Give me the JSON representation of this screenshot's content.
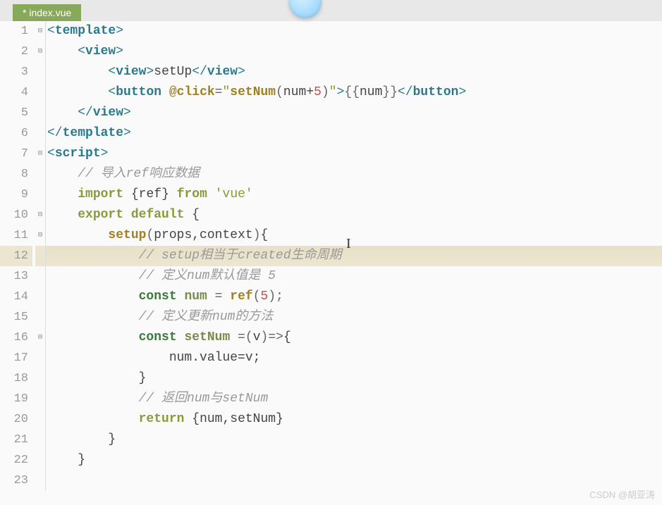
{
  "tab": {
    "title": "* index.vue"
  },
  "watermark": "CSDN @胡亚涛",
  "lines": [
    {
      "num": "1",
      "fold": "⊟",
      "hl": false
    },
    {
      "num": "2",
      "fold": "⊟",
      "hl": false
    },
    {
      "num": "3",
      "fold": "",
      "hl": false
    },
    {
      "num": "4",
      "fold": "",
      "hl": false
    },
    {
      "num": "5",
      "fold": "",
      "hl": false
    },
    {
      "num": "6",
      "fold": "",
      "hl": false
    },
    {
      "num": "7",
      "fold": "⊟",
      "hl": false
    },
    {
      "num": "8",
      "fold": "",
      "hl": false
    },
    {
      "num": "9",
      "fold": "",
      "hl": false
    },
    {
      "num": "10",
      "fold": "⊟",
      "hl": false
    },
    {
      "num": "11",
      "fold": "⊟",
      "hl": false
    },
    {
      "num": "12",
      "fold": "",
      "hl": true
    },
    {
      "num": "13",
      "fold": "",
      "hl": false
    },
    {
      "num": "14",
      "fold": "",
      "hl": false
    },
    {
      "num": "15",
      "fold": "",
      "hl": false
    },
    {
      "num": "16",
      "fold": "⊟",
      "hl": false
    },
    {
      "num": "17",
      "fold": "",
      "hl": false
    },
    {
      "num": "18",
      "fold": "",
      "hl": false
    },
    {
      "num": "19",
      "fold": "",
      "hl": false
    },
    {
      "num": "20",
      "fold": "",
      "hl": false
    },
    {
      "num": "21",
      "fold": "",
      "hl": false
    },
    {
      "num": "22",
      "fold": "",
      "hl": false
    },
    {
      "num": "23",
      "fold": "",
      "hl": false
    }
  ],
  "code": {
    "l1": {
      "p1": "<",
      "p2": "template",
      "p3": ">"
    },
    "l2": {
      "indent": "    ",
      "p1": "<",
      "p2": "view",
      "p3": ">"
    },
    "l3": {
      "indent": "        ",
      "p1": "<",
      "p2": "view",
      "p3": ">",
      "text": "setUp",
      "p4": "</",
      "p5": "view",
      "p6": ">"
    },
    "l4": {
      "indent": "        ",
      "p1": "<",
      "p2": "button",
      "sp": " ",
      "attr": "@click",
      "eq": "=",
      "q1": "\"",
      "fn": "setNum",
      "paren1": "(",
      "arg": "num+",
      "num": "5",
      "paren2": ")",
      "q2": "\"",
      "p3": ">",
      "open": "{{",
      "var": "num",
      "close": "}}",
      "p4": "</",
      "p5": "button",
      "p6": ">"
    },
    "l5": {
      "indent": "    ",
      "p1": "</",
      "p2": "view",
      "p3": ">"
    },
    "l6": {
      "p1": "</",
      "p2": "template",
      "p3": ">"
    },
    "l7": {
      "p1": "<",
      "p2": "script",
      "p3": ">"
    },
    "l8": {
      "indent": "    ",
      "comment": "// 导入ref响应数据"
    },
    "l9": {
      "indent": "    ",
      "kw": "import",
      "sp1": " ",
      "b1": "{",
      "name": "ref",
      "b2": "}",
      "sp2": " ",
      "kw2": "from",
      "sp3": " ",
      "str": "'vue'"
    },
    "l10": {
      "indent": "    ",
      "kw": "export",
      "sp": " ",
      "kw2": "default",
      "sp2": " ",
      "b": "{"
    },
    "l11": {
      "indent": "        ",
      "fn": "setup",
      "p1": "(",
      "args": "props,context",
      "p2": ")",
      "b": "{"
    },
    "l12": {
      "indent": "            ",
      "comment": "// setup相当于created生命周期"
    },
    "l13": {
      "indent": "            ",
      "comment": "// 定义num默认值是 5"
    },
    "l14": {
      "indent": "            ",
      "kw": "const",
      "sp": " ",
      "name": "num",
      "sp2": " ",
      "eq": "=",
      "sp3": " ",
      "fn": "ref",
      "p1": "(",
      "num": "5",
      "p2": ")",
      "semi": ";"
    },
    "l15": {
      "indent": "            ",
      "comment": "// 定义更新num的方法"
    },
    "l16": {
      "indent": "            ",
      "kw": "const",
      "sp": " ",
      "name": "setNum",
      "sp2": " ",
      "eq": "=",
      "p1": "(",
      "arg": "v",
      "p2": ")",
      "arrow": "=>",
      "b": "{"
    },
    "l17": {
      "indent": "                ",
      "expr": "num.value=v;"
    },
    "l18": {
      "indent": "            ",
      "b": "}"
    },
    "l19": {
      "indent": "            ",
      "comment": "// 返回num与setNum"
    },
    "l20": {
      "indent": "            ",
      "kw": "return",
      "sp": " ",
      "b1": "{",
      "args": "num,setNum",
      "b2": "}"
    },
    "l21": {
      "indent": "        ",
      "b": "}"
    },
    "l22": {
      "indent": "    ",
      "b": "}"
    },
    "l23": {
      "indent": ""
    }
  }
}
